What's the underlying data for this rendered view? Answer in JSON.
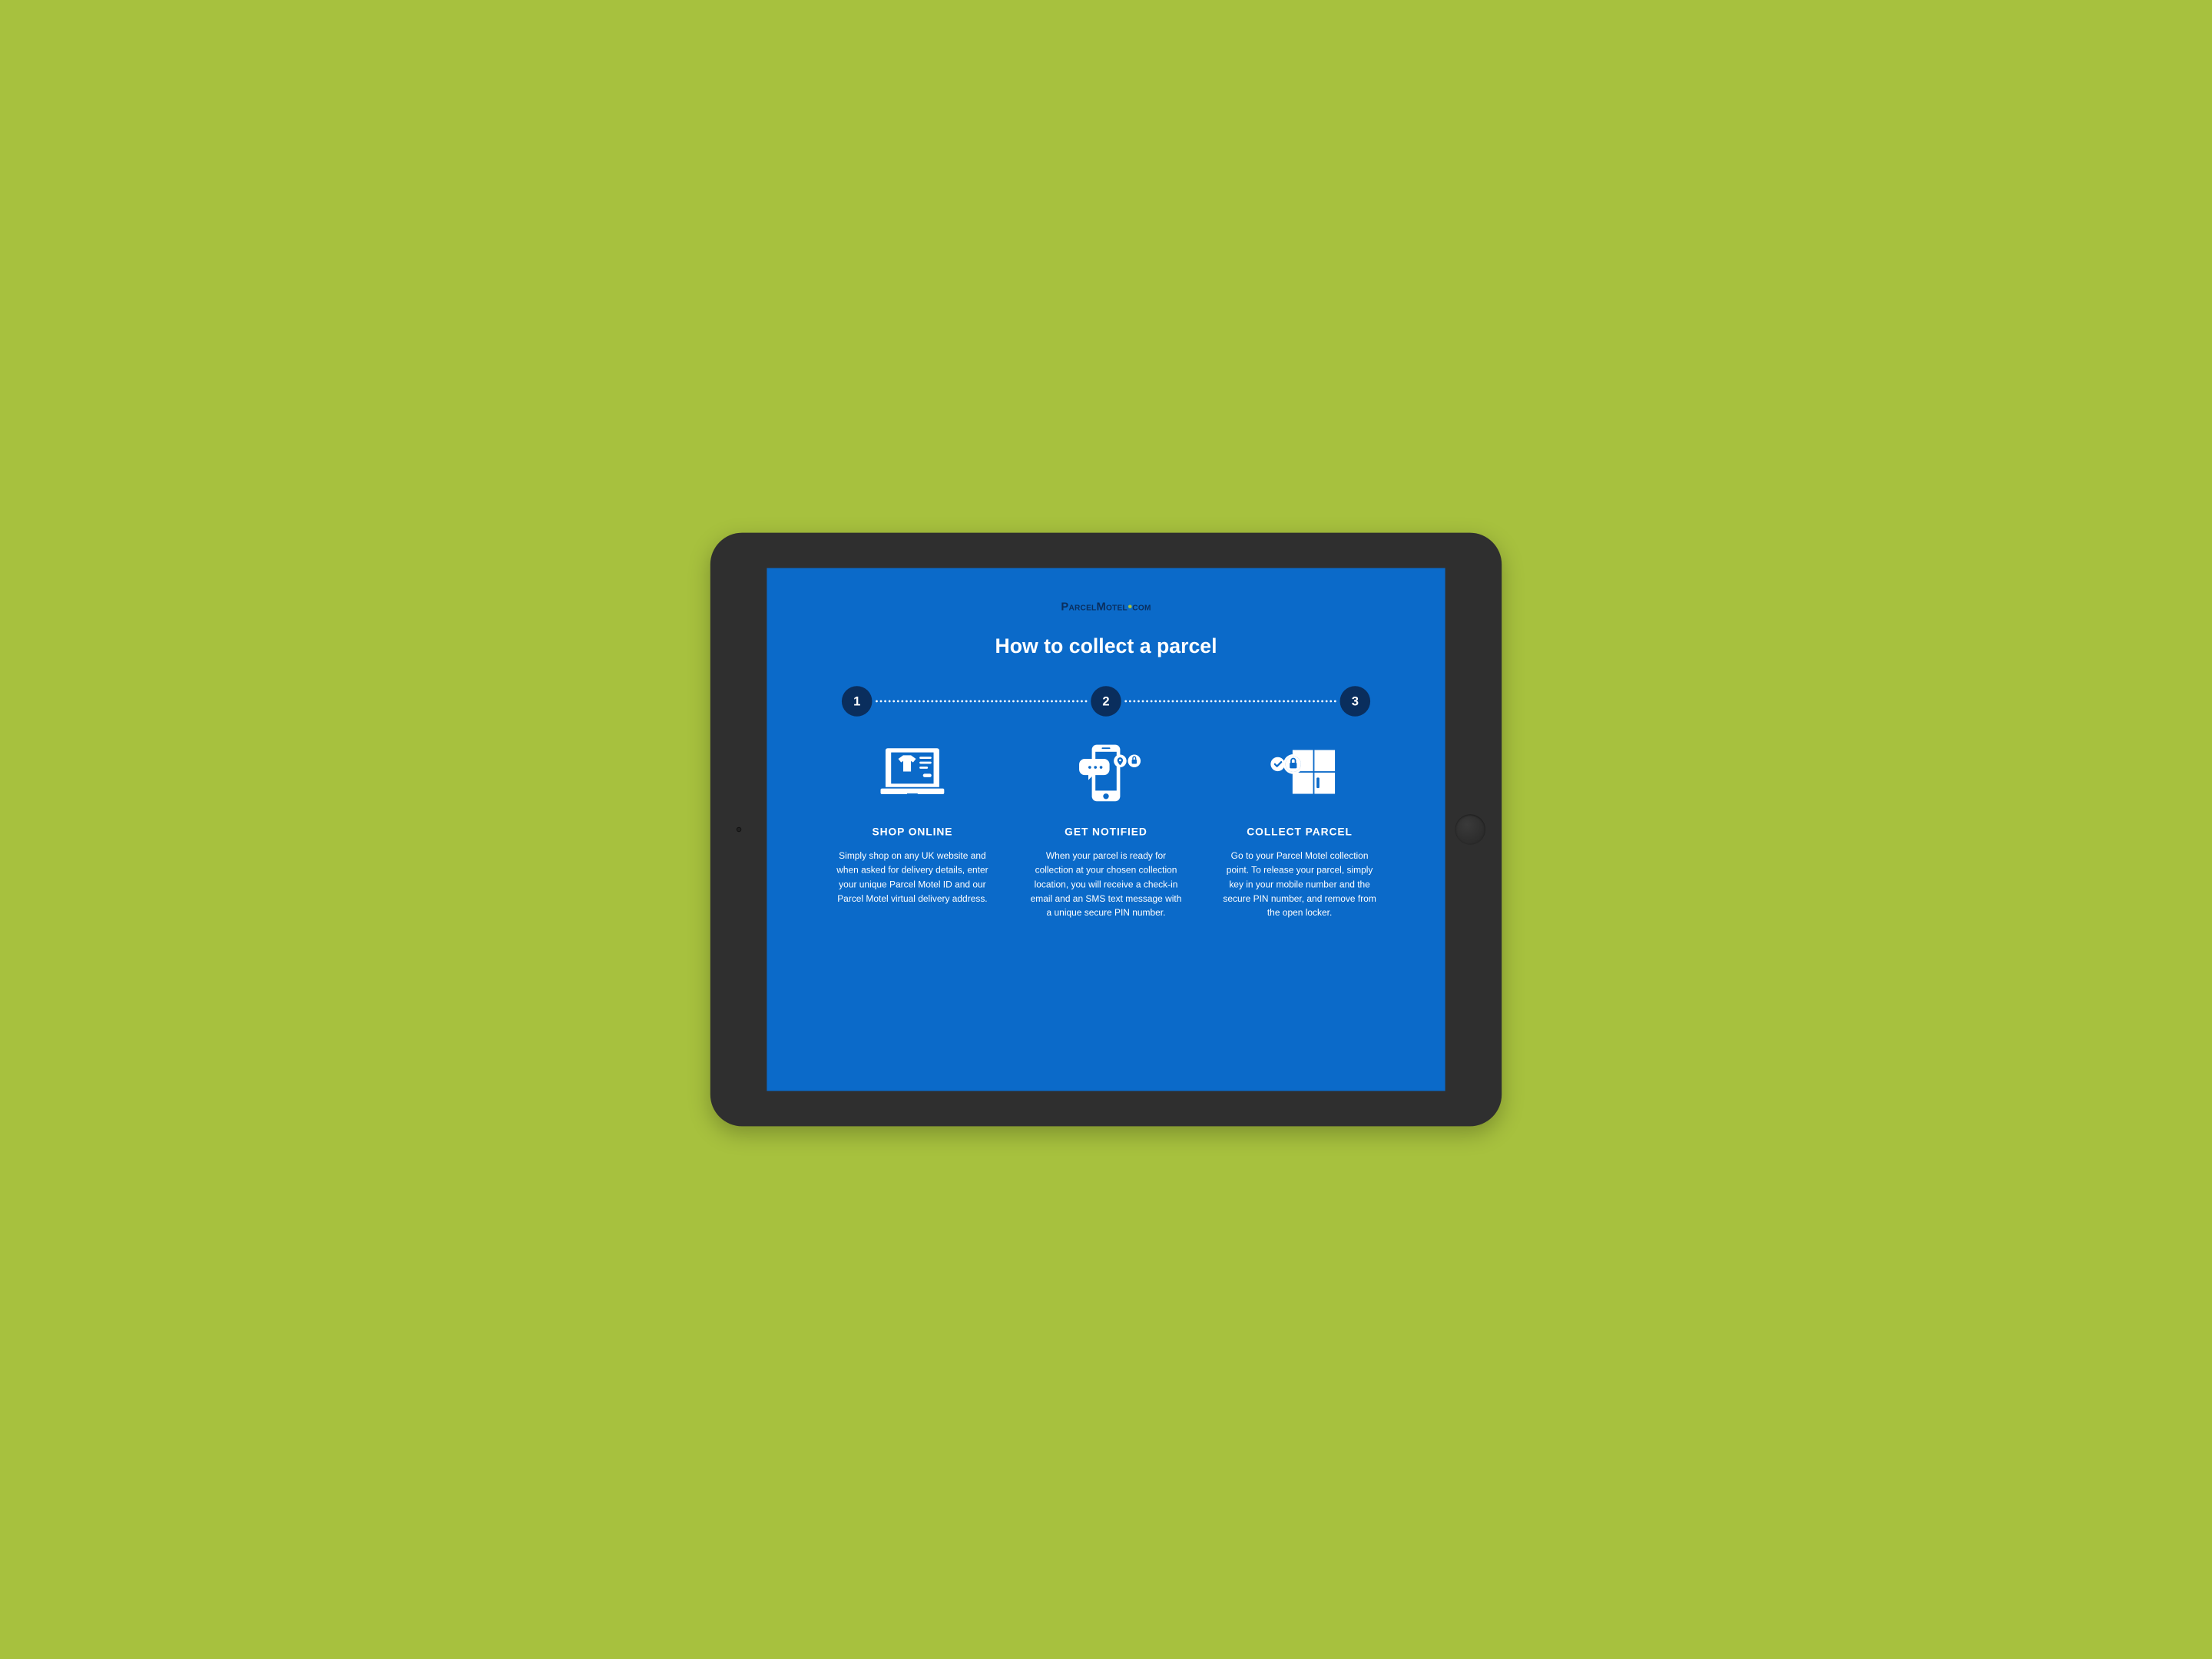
{
  "logo": {
    "part1": "Parcel",
    "part2": "Motel",
    "part3": "com"
  },
  "title": "How to collect a parcel",
  "steps": [
    {
      "num": "1",
      "title": "SHOP ONLINE",
      "desc": "Simply shop on any UK website and when asked for delivery details, enter your unique Parcel Motel ID and our Parcel Motel virtual delivery address."
    },
    {
      "num": "2",
      "title": "GET NOTIFIED",
      "desc": "When your parcel is ready for collection at your chosen collection location, you will receive a check-in email and an SMS text message with a unique secure PIN number."
    },
    {
      "num": "3",
      "title": "COLLECT PARCEL",
      "desc": "Go to your Parcel Motel collection point. To release your parcel, simply key in your mobile number and the secure PIN number, and remove from the open locker."
    }
  ]
}
